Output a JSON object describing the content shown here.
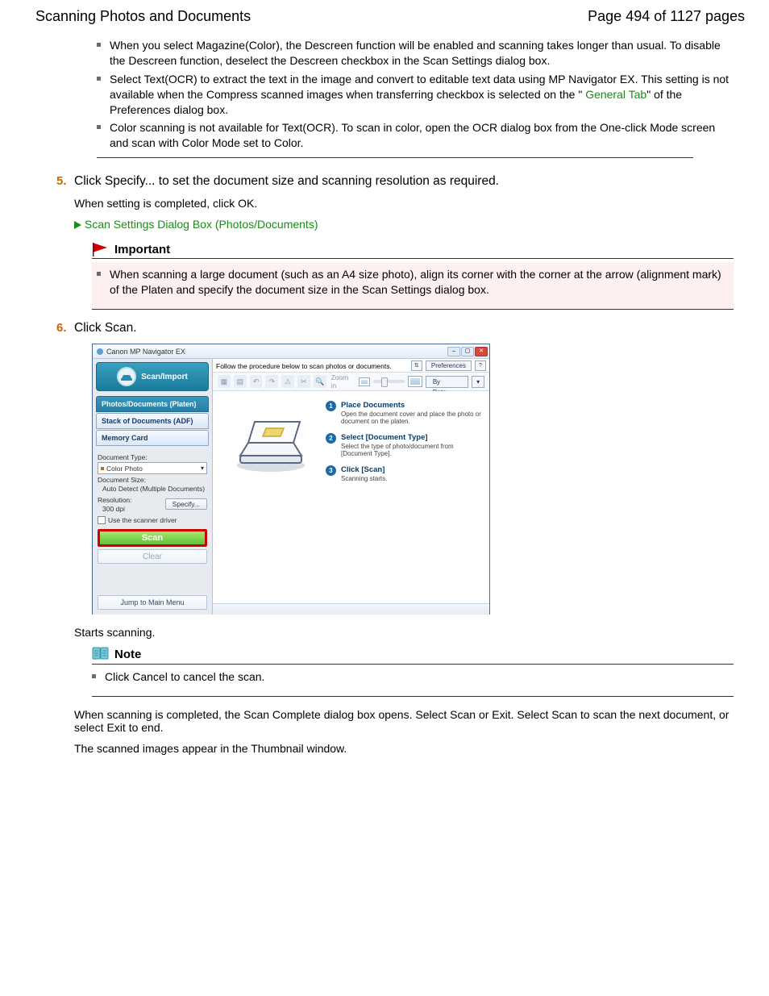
{
  "header": {
    "title": "Scanning Photos and Documents",
    "page_indicator": "Page 494 of 1127 pages"
  },
  "topBullets": [
    "When you select Magazine(Color), the Descreen function will be enabled and scanning takes longer than usual. To disable the Descreen function, deselect the Descreen checkbox in the Scan Settings dialog box.",
    "Select Text(OCR) to extract the text in the image and convert to editable text data using MP Navigator EX. This setting is not available when the Compress scanned images when transferring checkbox is selected on the \" ",
    "Color scanning is not available for Text(OCR). To scan in color, open the OCR dialog box from the One-click Mode screen and scan with Color Mode set to Color."
  ],
  "generalTabLink": "General Tab",
  "generalTabTail": "\" of the Preferences dialog box.",
  "step5": {
    "num": "5.",
    "title": "Click Specify... to set the document size and scanning resolution as required.",
    "body": "When setting is completed, click OK.",
    "link": "Scan Settings Dialog Box (Photos/Documents)"
  },
  "important": {
    "title": "Important",
    "bullet": "When scanning a large document (such as an A4 size photo), align its corner with the corner at the arrow (alignment mark) of the Platen and specify the document size in the Scan Settings dialog box."
  },
  "step6": {
    "num": "6.",
    "title": "Click Scan."
  },
  "screenshot": {
    "title": "Canon MP Navigator EX",
    "sidehead": "Scan/Import",
    "tabs": [
      "Photos/Documents (Platen)",
      "Stack of Documents (ADF)",
      "Memory Card"
    ],
    "doctype_label": "Document Type:",
    "doctype_value": "Color Photo",
    "docsize_label": "Document Size:",
    "docsize_value": "Auto Detect (Multiple Documents)",
    "res_label": "Resolution:",
    "res_value": "300 dpi",
    "specify_btn": "Specify...",
    "use_driver": "Use the scanner driver",
    "scan_btn": "Scan",
    "clear_btn": "Clear",
    "jump_btn": "Jump to Main Menu",
    "follow_text": "Follow the procedure below to scan photos or documents.",
    "guide_btn": "⇅",
    "prefs_btn": "Preferences",
    "help_btn": "?",
    "zoom_label": "Zoom in",
    "sort_label": "By Date",
    "steps": [
      {
        "n": "1",
        "title": "Place Documents",
        "body": "Open the document cover and place the photo or document on the platen."
      },
      {
        "n": "2",
        "title": "Select [Document Type]",
        "body": "Select the type of photo/document from [Document Type]."
      },
      {
        "n": "3",
        "title": "Click [Scan]",
        "body": "Scanning starts."
      }
    ]
  },
  "afterScan": "Starts scanning.",
  "note": {
    "title": "Note",
    "bullet": "Click Cancel to cancel the scan."
  },
  "tail1": "When scanning is completed, the Scan Complete dialog box opens. Select Scan or Exit. Select Scan to scan the next document, or select Exit to end.",
  "tail2": "The scanned images appear in the Thumbnail window."
}
